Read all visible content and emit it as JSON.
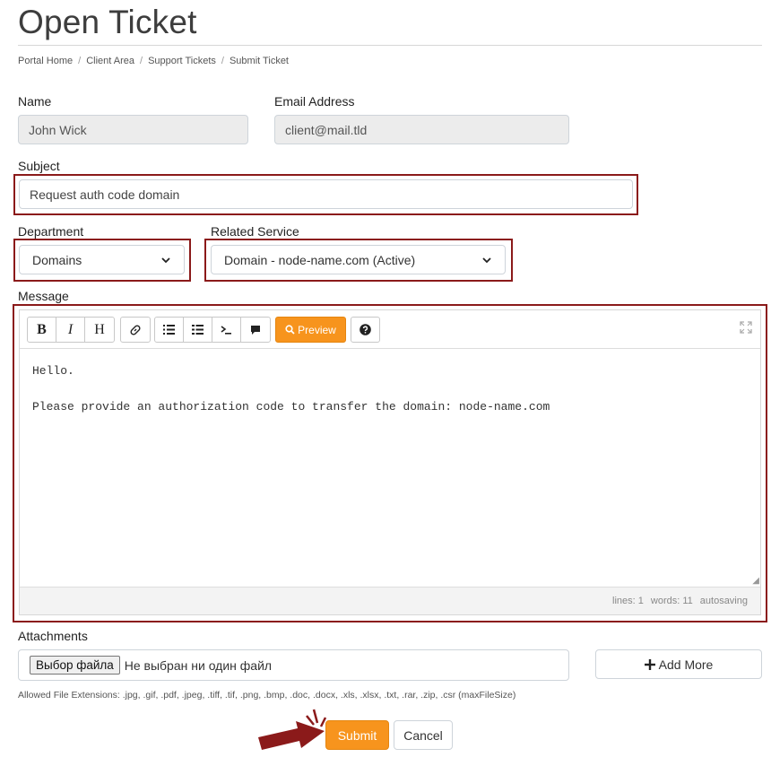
{
  "page": {
    "title": "Open Ticket"
  },
  "breadcrumb": {
    "items": [
      "Portal Home",
      "Client Area",
      "Support Tickets",
      "Submit Ticket"
    ],
    "separator": "/"
  },
  "form": {
    "name_label": "Name",
    "name_value": "John Wick",
    "email_label": "Email Address",
    "email_value": "client@mail.tld",
    "subject_label": "Subject",
    "subject_value": "Request auth code domain",
    "department_label": "Department",
    "department_value": "Domains",
    "service_label": "Related Service",
    "service_value": "Domain - node-name.com (Active)",
    "message_label": "Message"
  },
  "editor": {
    "toolbar": {
      "bold": "B",
      "italic": "I",
      "heading": "H",
      "preview_label": "Preview"
    },
    "content": "Hello.\n\nPlease provide an authorization code to transfer the domain: node-name.com",
    "status": {
      "lines": "lines: 1",
      "words": "words: 11",
      "autosave": "autosaving"
    }
  },
  "attachments": {
    "label": "Attachments",
    "choose_button": "Выбор файла",
    "no_file_text": "Не выбран ни один файл",
    "add_more_label": "Add More",
    "allowed_text": "Allowed File Extensions: .jpg, .gif, .pdf, .jpeg, .tiff, .tif, .png, .bmp, .doc, .docx, .xls, .xlsx, .txt, .rar, .zip, .csr (maxFileSize)"
  },
  "actions": {
    "submit_label": "Submit",
    "cancel_label": "Cancel"
  },
  "colors": {
    "accent": "#f7941d",
    "highlight": "#8b1a1a",
    "arrow": "#8b1a1a"
  },
  "icons": {
    "link": "link-icon",
    "ul": "unordered-list-icon",
    "ol": "ordered-list-icon",
    "code": "code-icon",
    "quote": "comment-icon",
    "preview": "search-icon",
    "help": "question-circle-icon",
    "fullscreen": "fullscreen-icon",
    "add": "plus-icon",
    "pointer": "arrow-icon"
  }
}
